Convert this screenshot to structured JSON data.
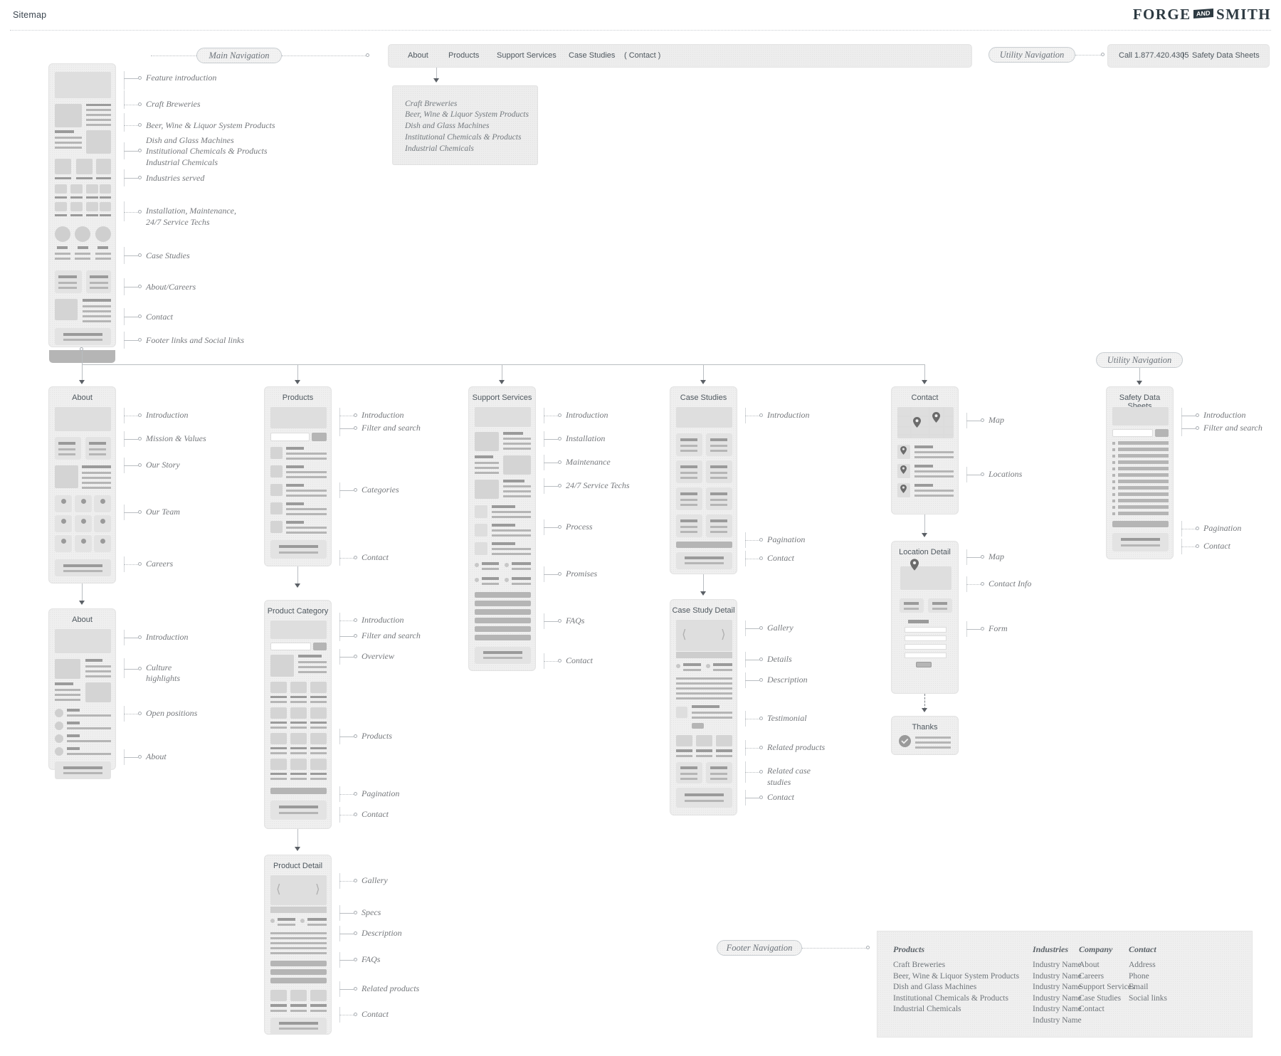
{
  "header": {
    "title": "Sitemap",
    "logo_left": "FORGE",
    "logo_mid": "AND",
    "logo_right": "SMITH"
  },
  "pills": {
    "main_nav": "Main Navigation",
    "utility_nav_top": "Utility Navigation",
    "utility_nav_right": "Utility Navigation",
    "footer_nav": "Footer Navigation"
  },
  "main_nav_bar": {
    "items": [
      "About",
      "Products",
      "Support Services",
      "Case Studies",
      "( Contact )"
    ]
  },
  "utility_bar": {
    "items": [
      "Call 1.877.420.4305",
      "|",
      "Safety Data Sheets"
    ]
  },
  "products_dropdown": {
    "items": [
      "Craft Breweries",
      "Beer, Wine & Liquor System Products",
      "Dish and Glass Machines",
      "Institutional Chemicals & Products",
      "Industrial Chemicals"
    ]
  },
  "home": {
    "notes": [
      "Feature introduction",
      "Craft Breweries",
      "Beer, Wine & Liquor System Products",
      "Dish and Glass Machines",
      "Institutional Chemicals & Products",
      "Industrial Chemicals",
      "Industries served",
      "Installation, Maintenance,",
      "24/7 Service Techs",
      "Case Studies",
      "About/Careers",
      "Contact",
      "Footer links and Social links"
    ]
  },
  "pages": {
    "about": {
      "title": "About",
      "notes": [
        "Introduction",
        "Mission & Values",
        "Our Story",
        "Our Team",
        "Careers"
      ]
    },
    "about_careers": {
      "title": "About",
      "notes": [
        "Introduction",
        "Culture",
        "highlights",
        "Open positions",
        "About"
      ]
    },
    "products": {
      "title": "Products",
      "notes": [
        "Introduction",
        "Filter and search",
        "Categories",
        "Contact"
      ]
    },
    "product_category": {
      "title": "Product Category",
      "notes": [
        "Introduction",
        "Filter and search",
        "Overview",
        "Products",
        "Pagination",
        "Contact"
      ]
    },
    "product_detail": {
      "title": "Product Detail",
      "notes": [
        "Gallery",
        "Specs",
        "Description",
        "FAQs",
        "Related products",
        "Contact"
      ]
    },
    "support_services": {
      "title": "Support Services",
      "notes": [
        "Introduction",
        "Installation",
        "Maintenance",
        "24/7 Service Techs",
        "Process",
        "Promises",
        "FAQs",
        "Contact"
      ]
    },
    "case_studies": {
      "title": "Case Studies",
      "notes": [
        "Introduction",
        "Pagination",
        "Contact"
      ]
    },
    "case_study_detail": {
      "title": "Case Study Detail",
      "notes": [
        "Gallery",
        "Details",
        "Description",
        "Testimonial",
        "Related products",
        "Related case",
        "studies",
        "Contact"
      ]
    },
    "contact": {
      "title": "Contact",
      "notes": [
        "Map",
        "Locations"
      ]
    },
    "location_detail": {
      "title": "Location Detail",
      "notes": [
        "Map",
        "Contact Info",
        "Form"
      ]
    },
    "thanks": {
      "title": "Thanks",
      "notes": []
    },
    "safety_data_sheets": {
      "title": "Safety Data Sheets",
      "notes": [
        "Introduction",
        "Filter and search",
        "Pagination",
        "Contact"
      ]
    }
  },
  "footer_nav": {
    "columns": [
      {
        "heading": "Products",
        "items": [
          "Craft Breweries",
          "Beer, Wine & Liquor System Products",
          "Dish and Glass Machines",
          "Institutional Chemicals & Products",
          "Industrial Chemicals"
        ]
      },
      {
        "heading": "Industries",
        "items": [
          "Industry Name",
          "Industry Name",
          "Industry Name",
          "Industry Name",
          "Industry Name",
          "Industry Name"
        ]
      },
      {
        "heading": "Company",
        "items": [
          "About",
          "Careers",
          "Support Services",
          "Case Studies",
          "Contact"
        ]
      },
      {
        "heading": "Contact",
        "items": [
          "Address",
          "Phone",
          "Email",
          "Social links"
        ]
      }
    ]
  },
  "colors": {
    "card_bg": "#efefef",
    "card_border": "#e2e2e2",
    "ink": "#4f585f",
    "note_ink": "#76797d",
    "logo": "#2d3a42"
  }
}
